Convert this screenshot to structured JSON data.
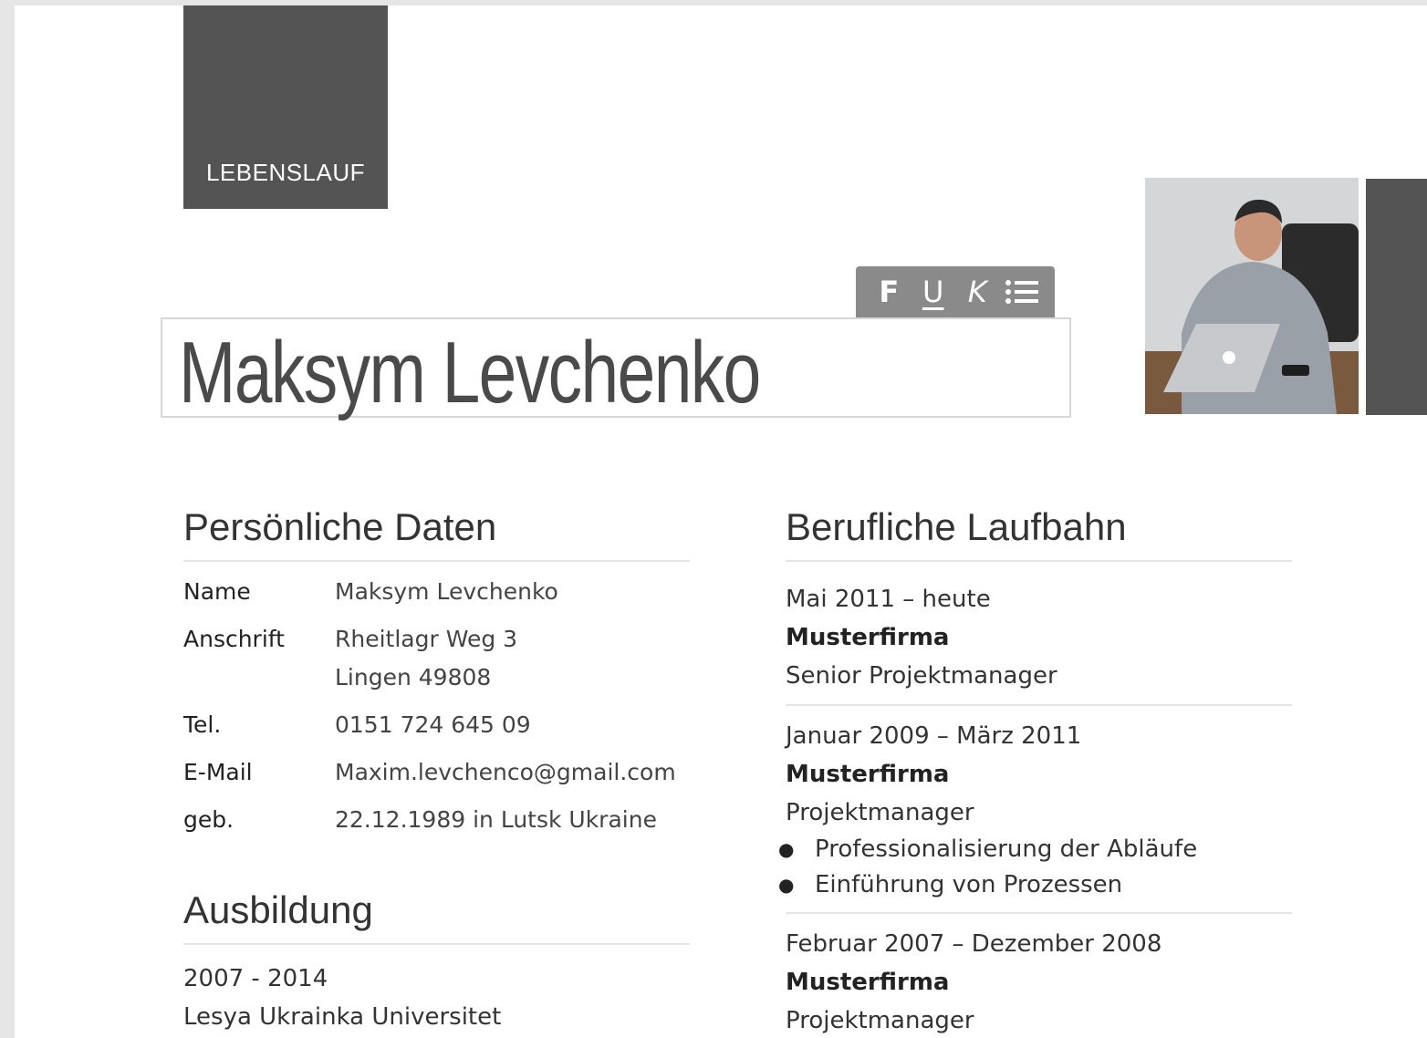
{
  "header": {
    "doc_title": "LEBENSLAUF",
    "name": "Maksym Levchenko"
  },
  "toolbar": {
    "bold_label": "F",
    "underline_label": "U",
    "italic_label": "K"
  },
  "personal": {
    "title": "Persönliche Daten",
    "rows": [
      {
        "key": "Name",
        "value": "Maksym Levchenko"
      },
      {
        "key": "Anschrift",
        "value": "Rheitlagr Weg 3",
        "value2": "Lingen 49808"
      },
      {
        "key": "Tel.",
        "value": "0151 724 645 09"
      },
      {
        "key": "E-Mail",
        "value": "Maxim.levchenco@gmail.com"
      },
      {
        "key": "geb.",
        "value": "22.12.1989 in Lutsk Ukraine"
      }
    ]
  },
  "education": {
    "title": "Ausbildung",
    "period": "2007 - 2014",
    "institution": "Lesya Ukrainka Universitet"
  },
  "career": {
    "title": "Berufliche Laufbahn",
    "jobs": [
      {
        "period": "Mai 2011 – heute",
        "company": "Musterfirma",
        "role": "Senior Projektmanager",
        "bullets": []
      },
      {
        "period": "Januar 2009 – März 2011",
        "company": "Musterfirma",
        "role": "Projektmanager",
        "bullets": [
          "Professionalisierung der Abläufe",
          "Einführung von Prozessen"
        ]
      },
      {
        "period": "Februar 2007 – Dezember 2008",
        "company": "Musterfirma",
        "role": "Projektmanager",
        "bullets": []
      }
    ]
  },
  "colors": {
    "dark_block": "#545454",
    "toolbar_bg": "#8a8a8a",
    "divider": "#e5e5e5"
  }
}
